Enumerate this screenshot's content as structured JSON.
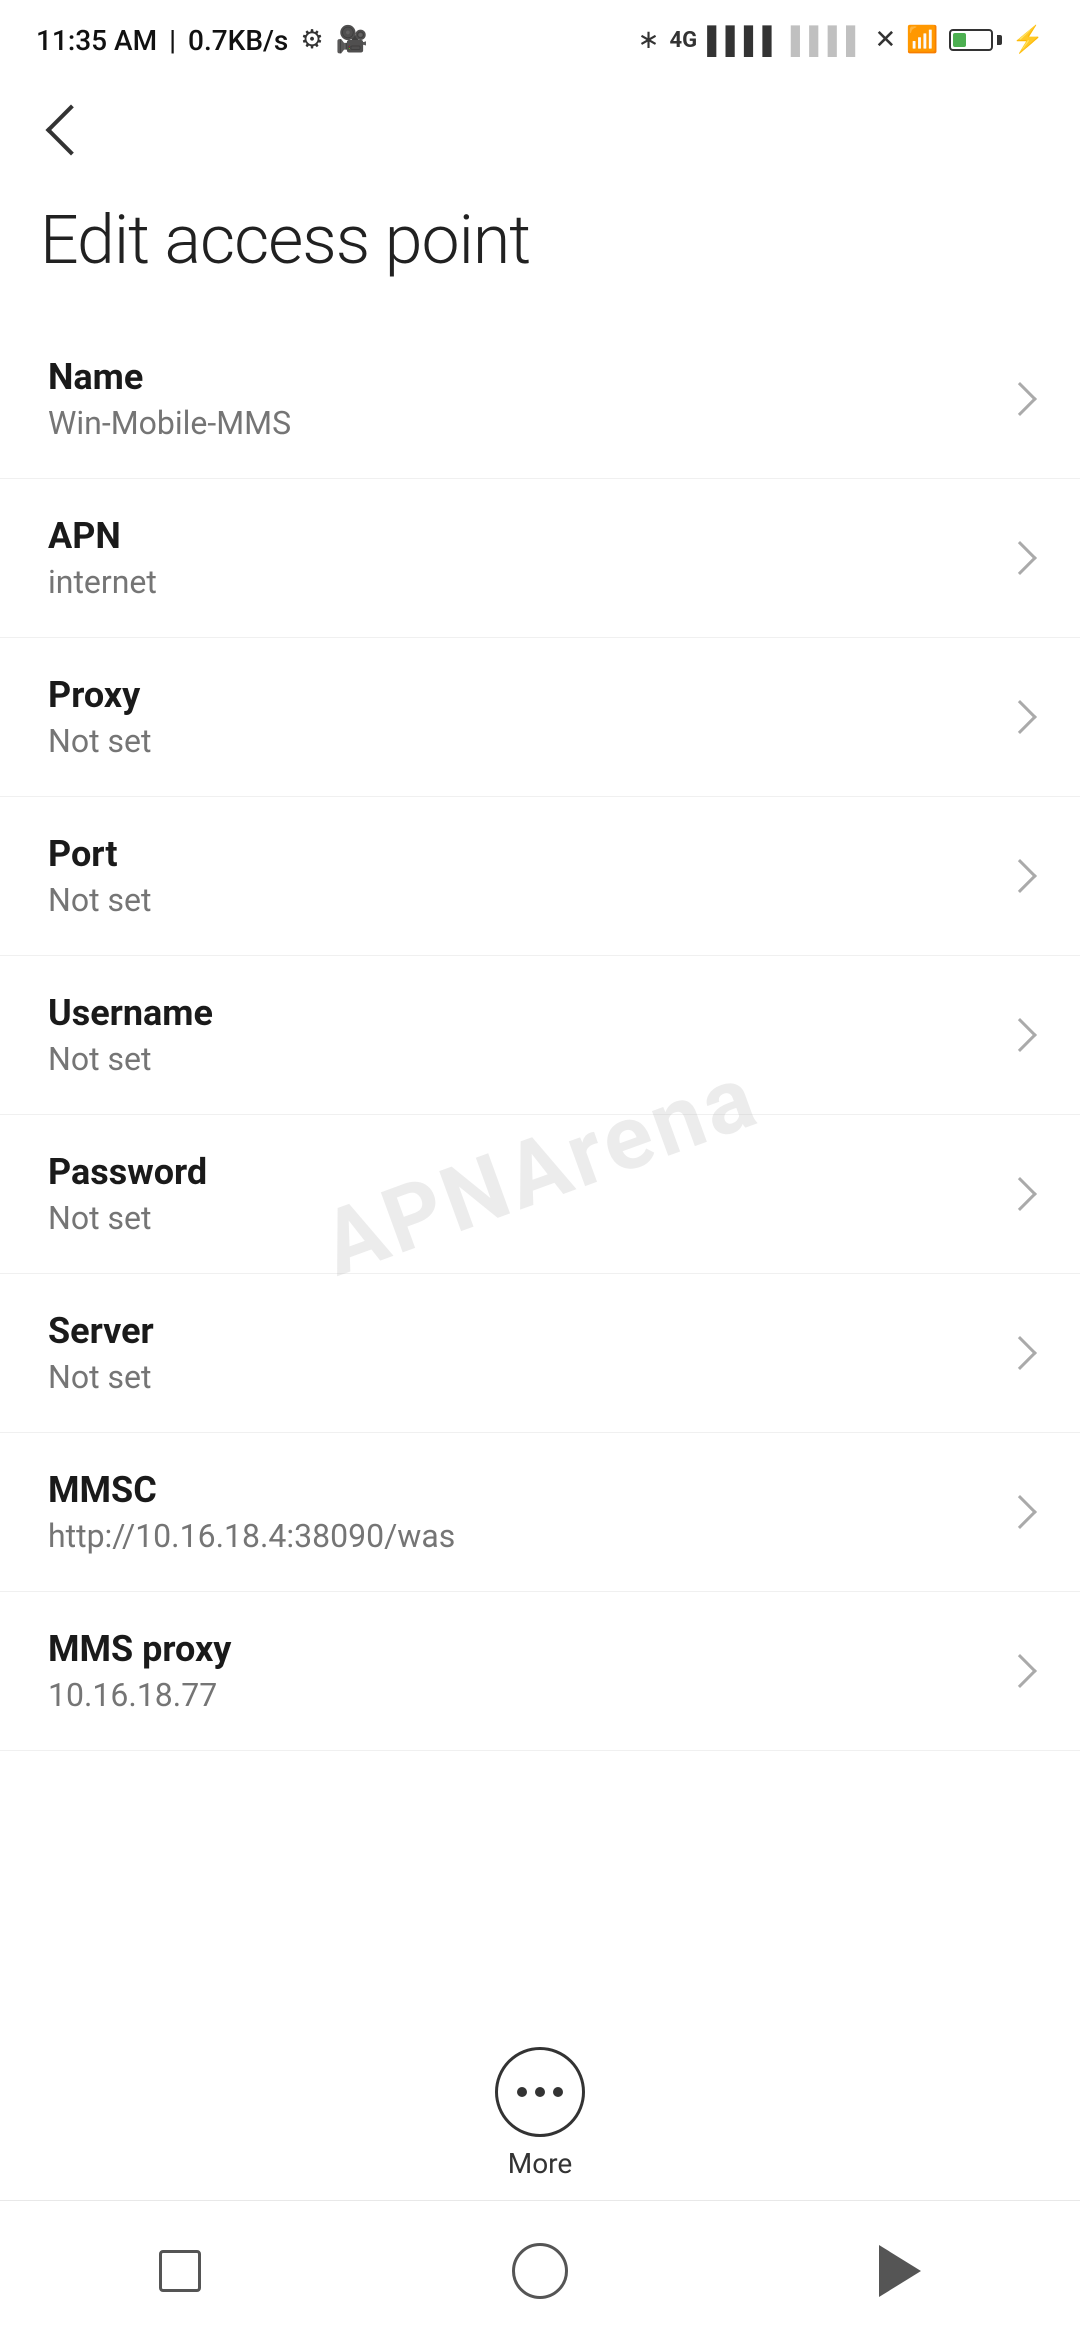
{
  "statusBar": {
    "time": "11:35 AM",
    "speed": "0.7KB/s"
  },
  "toolbar": {
    "backLabel": "back"
  },
  "page": {
    "title": "Edit access point"
  },
  "settings": [
    {
      "label": "Name",
      "value": "Win-Mobile-MMS"
    },
    {
      "label": "APN",
      "value": "internet"
    },
    {
      "label": "Proxy",
      "value": "Not set"
    },
    {
      "label": "Port",
      "value": "Not set"
    },
    {
      "label": "Username",
      "value": "Not set"
    },
    {
      "label": "Password",
      "value": "Not set"
    },
    {
      "label": "Server",
      "value": "Not set"
    },
    {
      "label": "MMSC",
      "value": "http://10.16.18.4:38090/was"
    },
    {
      "label": "MMS proxy",
      "value": "10.16.18.77"
    }
  ],
  "moreButton": {
    "label": "More"
  },
  "watermark": "APNArena"
}
